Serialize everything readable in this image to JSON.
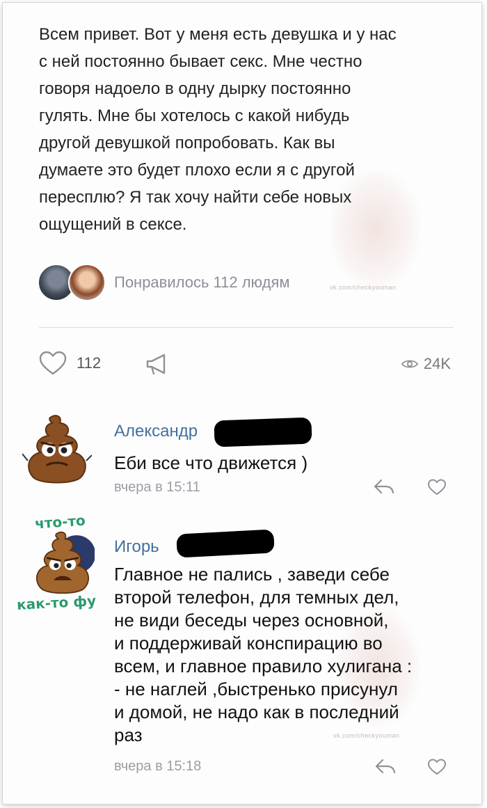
{
  "post": {
    "lines": [
      "Всем привет. Вот у меня есть девушка и у нас",
      "с ней постоянно бывает секс. Мне честно",
      "говоря надоело в одну дырку постоянно",
      "гулять. Мне бы хотелось с какой нибудь",
      "другой девушкой попробовать. Как вы",
      "думаете это будет плохо если я с другой",
      "пересплю? Я так хочу найти себе новых",
      "ощущений в сексе."
    ],
    "liked_by_text": "Понравилось 112 людям"
  },
  "actions": {
    "like_icon": "heart-outline-icon",
    "like_count": "112",
    "share_icon": "megaphone-icon",
    "views_icon": "eye-icon",
    "views_count": "24K"
  },
  "comments": [
    {
      "author": "Александр",
      "text_lines": [
        "Еби все что движется )"
      ],
      "time": "вчера в 15:11",
      "reply_icon": "reply-arrow-icon",
      "like_icon": "heart-outline-icon"
    },
    {
      "author": "Игорь",
      "sticker_top": "что-то",
      "sticker_bottom": "как-то фу",
      "text_lines": [
        "Главное не пались , заведи себе",
        "второй телефон, для темных дел,",
        "не види беседы через основной,",
        "и поддерживай конспирацию во",
        "всем, и главное правило хулигана :",
        "- не наглей ,быстренько присунул",
        "и домой, не надо как в последний",
        "раз"
      ],
      "time": "вчера в 15:18",
      "reply_icon": "reply-arrow-icon",
      "like_icon": "heart-outline-icon"
    }
  ],
  "watermark": {
    "text": "vk.com/checkyouman"
  },
  "colors": {
    "link": "#43709e",
    "muted": "#8b8f96",
    "sticker_caption": "#2c9a6e"
  }
}
